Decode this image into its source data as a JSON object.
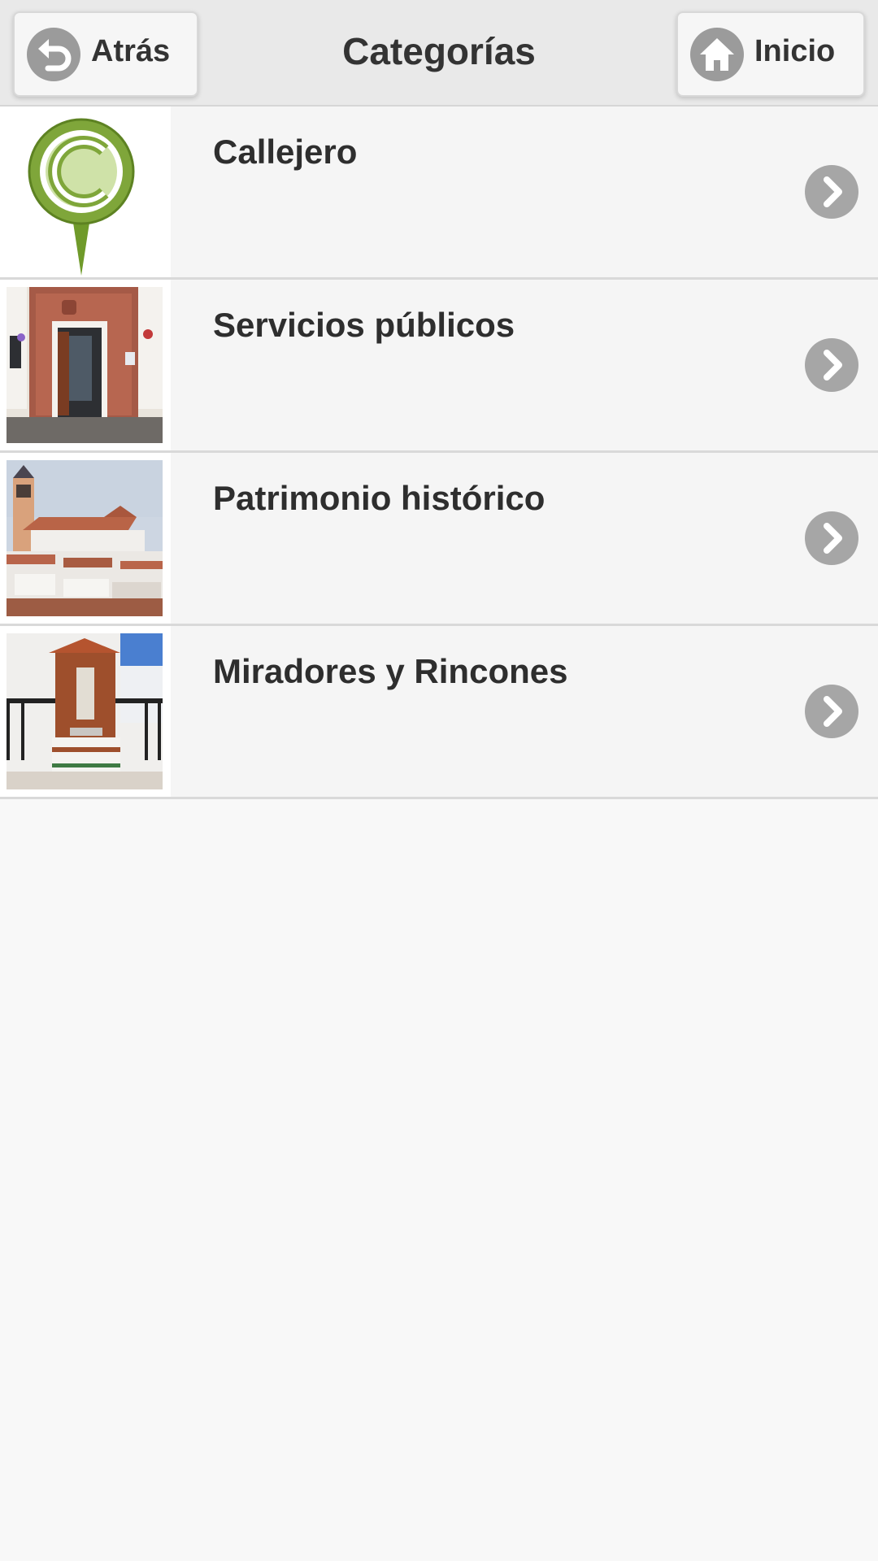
{
  "header": {
    "title": "Categorías",
    "back_label": "Atrás",
    "home_label": "Inicio"
  },
  "categories": [
    {
      "label": "Callejero"
    },
    {
      "label": "Servicios públicos"
    },
    {
      "label": "Patrimonio histórico"
    },
    {
      "label": "Miradores y Rincones"
    }
  ],
  "colors": {
    "header_bg": "#e9e9e9",
    "button_icon": "#9b9b9b",
    "chevron_bg": "#a6a6a6",
    "text": "#333333",
    "pin_green": "#7fa63a"
  },
  "icons": {
    "back": "back-arrow-icon",
    "home": "home-icon",
    "row_action": "chevron-right-icon",
    "callejero": "map-pin-c-icon"
  }
}
